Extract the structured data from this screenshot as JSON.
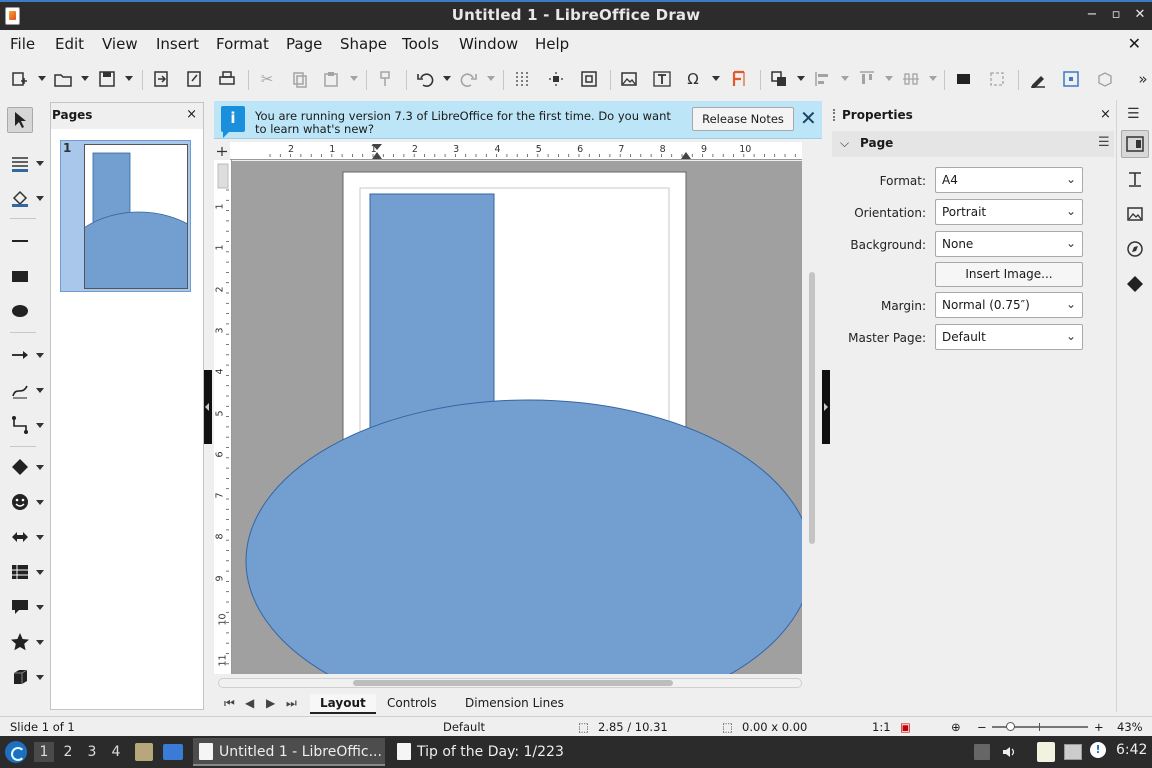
{
  "window": {
    "title": "Untitled 1 - LibreOffice Draw",
    "controls": [
      "−",
      "▫",
      "✕"
    ]
  },
  "menubar": {
    "items": [
      "File",
      "Edit",
      "View",
      "Insert",
      "Format",
      "Page",
      "Shape",
      "Tools",
      "Window",
      "Help"
    ],
    "close_doc": "✕"
  },
  "pages_pane": {
    "title": "Pages",
    "close": "×",
    "thumbnails": [
      {
        "number": "1"
      }
    ]
  },
  "infobar": {
    "icon_glyph": "i",
    "message": "You are running version 7.3 of LibreOffice for the first time. Do you want to learn what's new?",
    "button": "Release Notes",
    "close": "✕"
  },
  "rulers": {
    "horizontal_ticks": [
      "2",
      "1",
      "1",
      "2",
      "3",
      "4",
      "5",
      "6",
      "7",
      "8",
      "9",
      "10"
    ],
    "vertical_ticks": [
      "1",
      "1",
      "2",
      "3",
      "4",
      "5",
      "6",
      "7",
      "8",
      "9",
      "10",
      "11"
    ]
  },
  "tabs": {
    "items": [
      "Layout",
      "Controls",
      "Dimension Lines"
    ],
    "active": "Layout",
    "nav": [
      "⏮",
      "◀",
      "▶",
      "⏭"
    ]
  },
  "properties": {
    "title": "Properties",
    "close": "×",
    "section": "Page",
    "fields": [
      {
        "label": "Format:",
        "value": "A4",
        "type": "select"
      },
      {
        "label": "Orientation:",
        "value": "Portrait",
        "type": "select"
      },
      {
        "label": "Background:",
        "value": "None",
        "type": "select"
      },
      {
        "label": "",
        "value": "Insert Image...",
        "type": "button"
      },
      {
        "label": "Margin:",
        "value": "Normal (0.75″)",
        "type": "select"
      },
      {
        "label": "Master Page:",
        "value": "Default",
        "type": "select"
      }
    ]
  },
  "statusbar": {
    "slide": "Slide 1 of 1",
    "master": "Default",
    "position": "2.85 / 10.31",
    "size": "0.00 x 0.00",
    "scale": "1:1",
    "zoom_minus": "−",
    "zoom_plus": "+",
    "zoom_level_percent": 43,
    "zoom": "43%"
  },
  "taskbar": {
    "workspaces": [
      "1",
      "2",
      "3",
      "4"
    ],
    "active_workspace": "1",
    "tasks": [
      {
        "label": "Untitled 1 - LibreOffic...",
        "active": true
      },
      {
        "label": "Tip of the Day: 1/223",
        "active": false
      }
    ],
    "clock": "6:42"
  },
  "colors": {
    "shape_fill": "#729fcf",
    "shape_stroke": "#3465a4",
    "infobar_bg": "#bde5f8",
    "titlebar_bg": "#2c2c2c"
  }
}
